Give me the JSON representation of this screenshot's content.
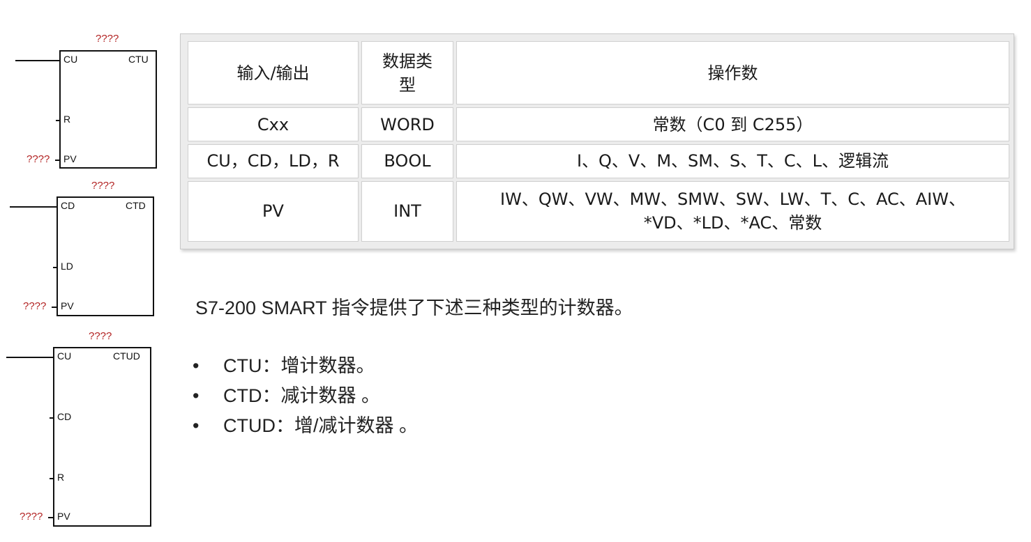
{
  "blocks": [
    {
      "name": "ctu",
      "title": "CTU",
      "top_label": "????",
      "pv_value": "????",
      "pins": [
        "CU",
        "R",
        "PV"
      ]
    },
    {
      "name": "ctd",
      "title": "CTD",
      "top_label": "????",
      "pv_value": "????",
      "pins": [
        "CD",
        "LD",
        "PV"
      ]
    },
    {
      "name": "ctud",
      "title": "CTUD",
      "top_label": "????",
      "pv_value": "????",
      "pins": [
        "CU",
        "CD",
        "R",
        "PV"
      ]
    }
  ],
  "table": {
    "headers": [
      "输入/输出",
      "数据类型",
      "操作数"
    ],
    "header_type_lines": [
      "数据类",
      "型"
    ],
    "rows": [
      {
        "io": "Cxx",
        "type": "WORD",
        "operands": [
          "常数（C0 到 C255）"
        ]
      },
      {
        "io": "CU，CD，LD，R",
        "type": "BOOL",
        "operands": [
          "I、Q、V、M、SM、S、T、C、L、逻辑流"
        ]
      },
      {
        "io": "PV",
        "type": "INT",
        "operands": [
          "IW、QW、VW、MW、SMW、SW、LW、T、C、AC、AIW、",
          "*VD、*LD、*AC、常数"
        ]
      }
    ]
  },
  "intro": "S7-200 SMART 指令提供了下述三种类型的计数器。",
  "bullet_symbol": "•",
  "bullets": [
    "CTU：增计数器。",
    "CTD：减计数器 。",
    "CTUD：增/减计数器 。"
  ]
}
